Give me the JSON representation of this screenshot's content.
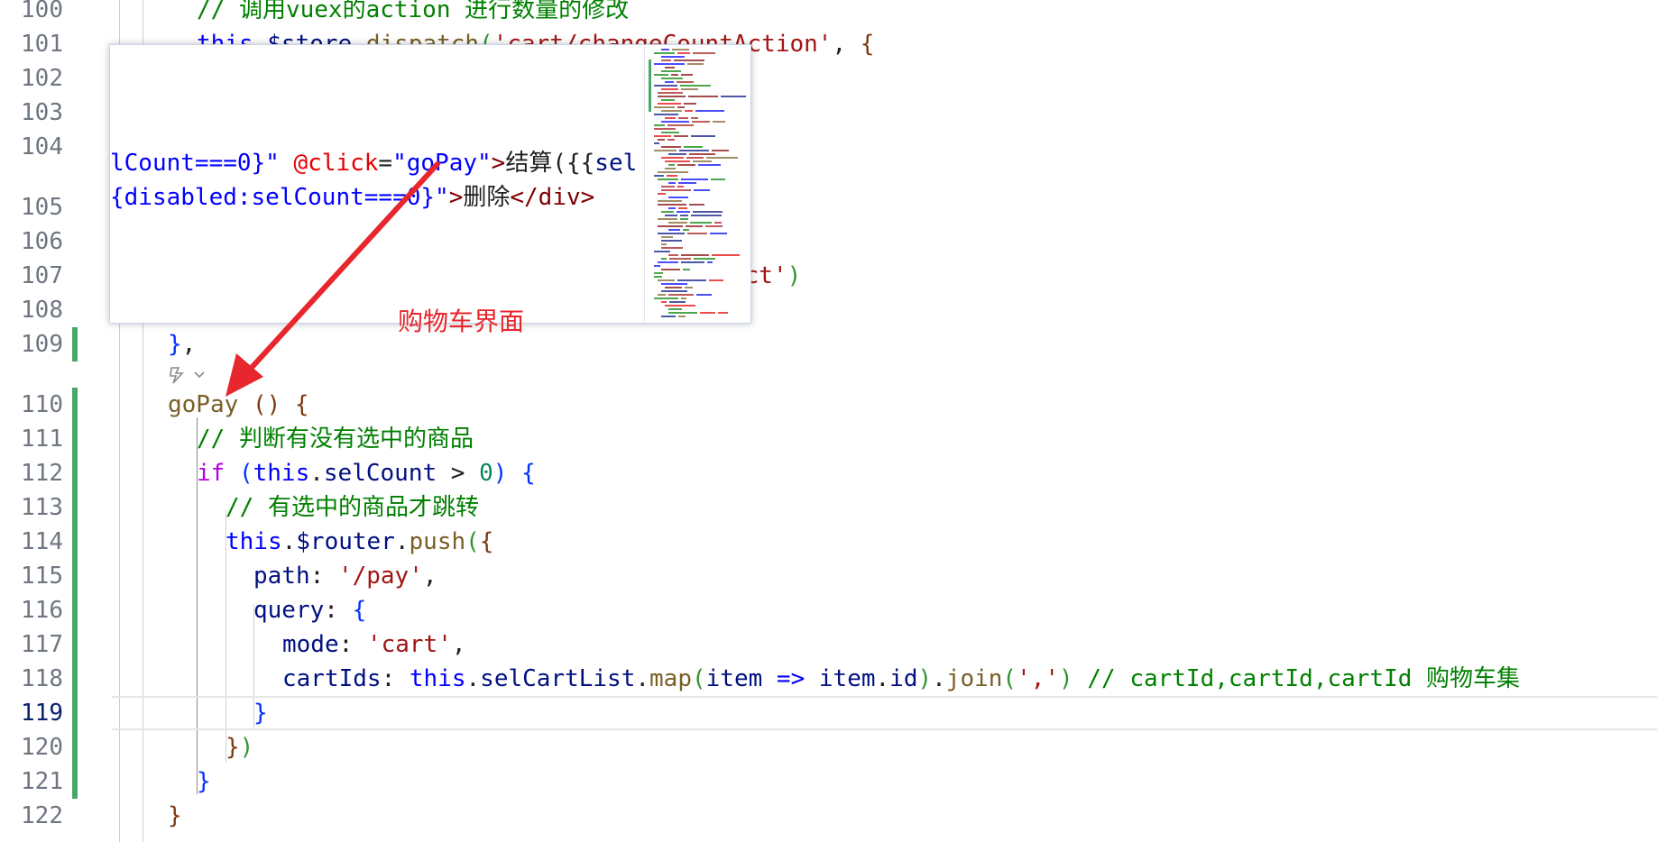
{
  "editor": {
    "lines": [
      {
        "num": "100",
        "segments": [
          [
            "c-comment",
            "// 调用vuex的action 进行数量的修改"
          ]
        ]
      },
      {
        "num": "101",
        "segments": [
          [
            "c-kw",
            "this"
          ],
          [
            "c-punct",
            "."
          ],
          [
            "c-prop",
            "$store"
          ],
          [
            "c-punct",
            "."
          ],
          [
            "c-fn",
            "dispatch"
          ],
          [
            "c-brace2",
            "("
          ],
          [
            "c-str",
            "'cart/changeCountAction'"
          ],
          [
            "c-punct",
            ", "
          ],
          [
            "c-brace3",
            "{"
          ]
        ]
      },
      {
        "num": "102",
        "segments": []
      },
      {
        "num": "103",
        "segments": []
      },
      {
        "num": "104",
        "segments": []
      },
      {
        "num": "105",
        "segments": []
      },
      {
        "num": "106",
        "segments": []
      },
      {
        "num": "107",
        "segments": [
          [
            "c-str",
            "ect'"
          ],
          [
            "c-brace2",
            ")"
          ]
        ]
      },
      {
        "num": "108",
        "segments": []
      },
      {
        "num": "109",
        "segments": [
          [
            "c-brace1",
            "}"
          ],
          [
            "c-punct",
            ","
          ]
        ]
      },
      {
        "num": "110",
        "segments": [
          [
            "c-fn",
            "goPay"
          ],
          [
            "c-punct",
            " "
          ],
          [
            "c-brace3",
            "()"
          ],
          [
            "c-punct",
            " "
          ],
          [
            "c-brace3",
            "{"
          ]
        ]
      },
      {
        "num": "111",
        "segments": [
          [
            "c-comment",
            "// 判断有没有选中的商品"
          ]
        ]
      },
      {
        "num": "112",
        "segments": [
          [
            "c-ctrl",
            "if"
          ],
          [
            "c-punct",
            " "
          ],
          [
            "c-brace1",
            "("
          ],
          [
            "c-kw",
            "this"
          ],
          [
            "c-punct",
            "."
          ],
          [
            "c-prop",
            "selCount"
          ],
          [
            "c-punct",
            " > "
          ],
          [
            "c-num",
            "0"
          ],
          [
            "c-brace1",
            ")"
          ],
          [
            "c-punct",
            " "
          ],
          [
            "c-brace1",
            "{"
          ]
        ]
      },
      {
        "num": "113",
        "segments": [
          [
            "c-comment",
            "// 有选中的商品才跳转"
          ]
        ]
      },
      {
        "num": "114",
        "segments": [
          [
            "c-kw",
            "this"
          ],
          [
            "c-punct",
            "."
          ],
          [
            "c-prop",
            "$router"
          ],
          [
            "c-punct",
            "."
          ],
          [
            "c-fn",
            "push"
          ],
          [
            "c-brace2",
            "("
          ],
          [
            "c-brace3",
            "{"
          ]
        ]
      },
      {
        "num": "115",
        "segments": [
          [
            "c-prop",
            "path"
          ],
          [
            "c-punct",
            ": "
          ],
          [
            "c-str",
            "'/pay'"
          ],
          [
            "c-punct",
            ","
          ]
        ]
      },
      {
        "num": "116",
        "segments": [
          [
            "c-prop",
            "query"
          ],
          [
            "c-punct",
            ": "
          ],
          [
            "c-brace1",
            "{"
          ]
        ]
      },
      {
        "num": "117",
        "segments": [
          [
            "c-prop",
            "mode"
          ],
          [
            "c-punct",
            ": "
          ],
          [
            "c-str",
            "'cart'"
          ],
          [
            "c-punct",
            ","
          ]
        ]
      },
      {
        "num": "118",
        "segments": [
          [
            "c-prop",
            "cartIds"
          ],
          [
            "c-punct",
            ": "
          ],
          [
            "c-kw",
            "this"
          ],
          [
            "c-punct",
            "."
          ],
          [
            "c-prop",
            "selCartList"
          ],
          [
            "c-punct",
            "."
          ],
          [
            "c-fn",
            "map"
          ],
          [
            "c-brace2",
            "("
          ],
          [
            "c-prop",
            "item"
          ],
          [
            "c-punct",
            " "
          ],
          [
            "c-kw",
            "=>"
          ],
          [
            "c-punct",
            " "
          ],
          [
            "c-prop",
            "item"
          ],
          [
            "c-punct",
            "."
          ],
          [
            "c-prop",
            "id"
          ],
          [
            "c-brace2",
            ")"
          ],
          [
            "c-punct",
            "."
          ],
          [
            "c-fn",
            "join"
          ],
          [
            "c-brace2",
            "("
          ],
          [
            "c-str",
            "','"
          ],
          [
            "c-brace2",
            ")"
          ],
          [
            "c-punct",
            " "
          ],
          [
            "c-comment",
            "// cartId,cartId,cartId 购物车集"
          ]
        ]
      },
      {
        "num": "119",
        "segments": [
          [
            "c-brace1",
            "}"
          ]
        ]
      },
      {
        "num": "120",
        "segments": [
          [
            "c-brace3",
            "}"
          ],
          [
            "c-brace2",
            ")"
          ]
        ]
      },
      {
        "num": "121",
        "segments": [
          [
            "c-brace1",
            "}"
          ]
        ]
      },
      {
        "num": "122",
        "segments": [
          [
            "c-brace3",
            "}"
          ]
        ]
      }
    ]
  },
  "popup": {
    "line1": [
      [
        "c-html-str",
        "lCount===0}\""
      ],
      [
        "c-punct",
        " "
      ],
      [
        "c-attr",
        "@click"
      ],
      [
        "c-punct",
        "="
      ],
      [
        "c-html-str",
        "\"goPay\""
      ],
      [
        "c-tag",
        ">"
      ],
      [
        "c-punct",
        "结算"
      ],
      [
        "c-punct",
        "("
      ],
      [
        "c-punct",
        "{{"
      ],
      [
        "c-prop",
        "sel"
      ]
    ],
    "line2": [
      [
        "c-html-str",
        "{disabled:selCount===0}\""
      ],
      [
        "c-tag",
        ">"
      ],
      [
        "c-punct",
        "删除"
      ],
      [
        "c-tag",
        "</div>"
      ]
    ]
  },
  "annotation": {
    "label": "购物车界面",
    "color": "#e8262d"
  }
}
